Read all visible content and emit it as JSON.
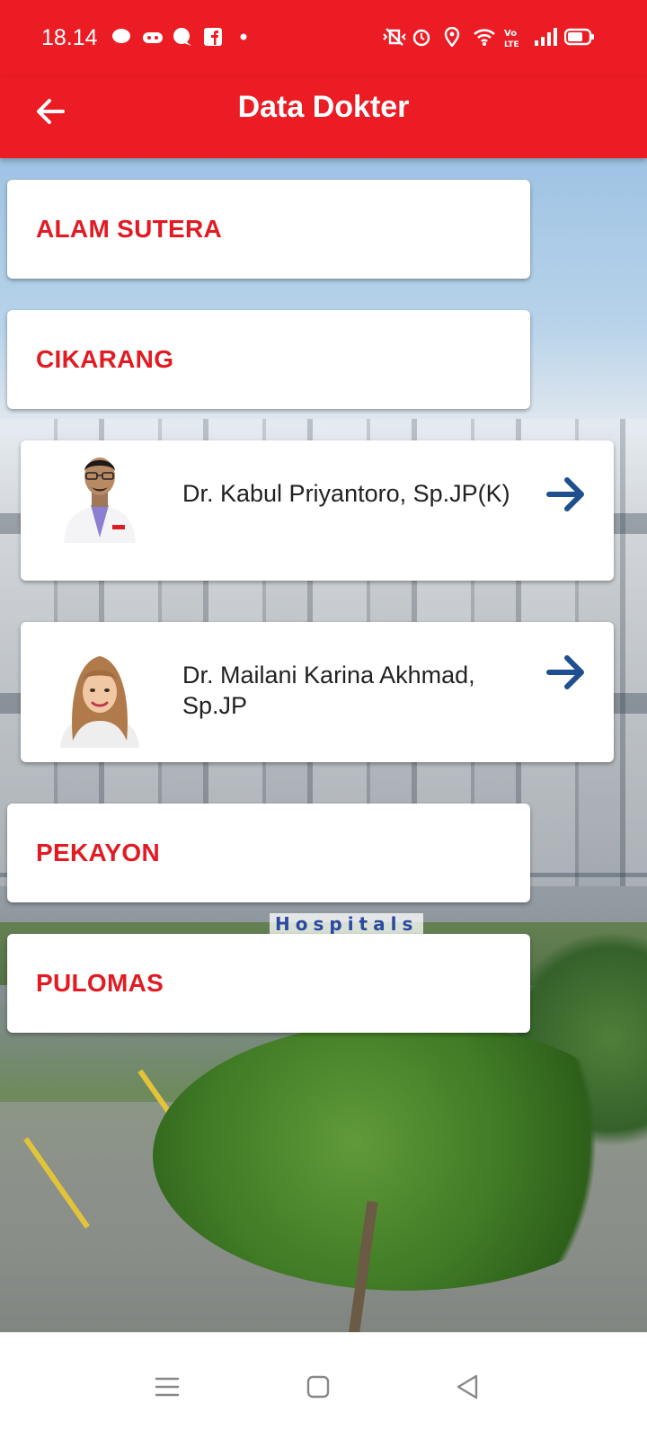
{
  "status_bar": {
    "time": "18.14",
    "left_icons": [
      "line-icon",
      "game-controller-icon",
      "chat-bubble-icon",
      "facebook-icon",
      "dot-icon"
    ],
    "right_icons": [
      "vibrate-off-icon",
      "alarm-icon",
      "location-icon",
      "wifi-icon",
      "volte-icon",
      "signal-icon",
      "battery-icon"
    ]
  },
  "app_bar": {
    "title": "Data Dokter",
    "back_icon": "arrow-left-icon"
  },
  "sections": [
    {
      "label": "ALAM SUTERA"
    },
    {
      "label": "CIKARANG"
    },
    {
      "label": "PEKAYON"
    },
    {
      "label": "PULOMAS"
    }
  ],
  "doctors": [
    {
      "name": "Dr. Kabul Priyantoro, Sp.JP(K)",
      "action_icon": "arrow-right-icon"
    },
    {
      "name": "Dr. Mailani Karina Akhmad, Sp.JP",
      "action_icon": "arrow-right-icon"
    }
  ],
  "background": {
    "sign_text": "Hospitals"
  },
  "nav_bar": {
    "buttons": [
      "menu-icon",
      "home-square-icon",
      "back-triangle-icon"
    ]
  },
  "colors": {
    "primary": "#ec1c24",
    "section_label": "#e21b23",
    "arrow": "#1f4f8f"
  }
}
